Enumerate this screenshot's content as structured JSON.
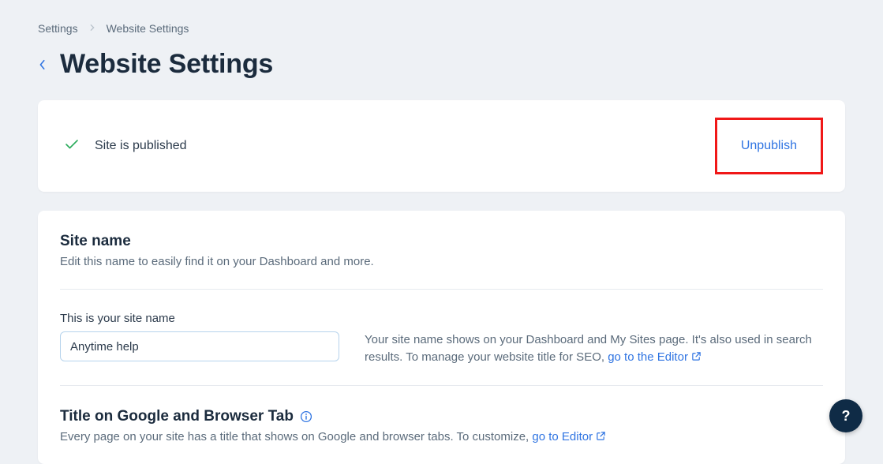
{
  "breadcrumb": {
    "root": "Settings",
    "current": "Website Settings"
  },
  "page_title": "Website Settings",
  "status": {
    "text": "Site is published",
    "action_label": "Unpublish"
  },
  "site_name_section": {
    "title": "Site name",
    "description": "Edit this name to easily find it on your Dashboard and more.",
    "field_label": "This is your site name",
    "value": "Anytime help",
    "helper_prefix": "Your site name shows on your Dashboard and My Sites page. It's also used in search results. To manage your website title for SEO, ",
    "helper_link": "go to the Editor"
  },
  "title_section": {
    "title": "Title on Google and Browser Tab",
    "desc_prefix": "Every page on your site has a title that shows on Google and browser tabs. To customize, ",
    "desc_link": "go to Editor"
  },
  "help_fab": "?"
}
